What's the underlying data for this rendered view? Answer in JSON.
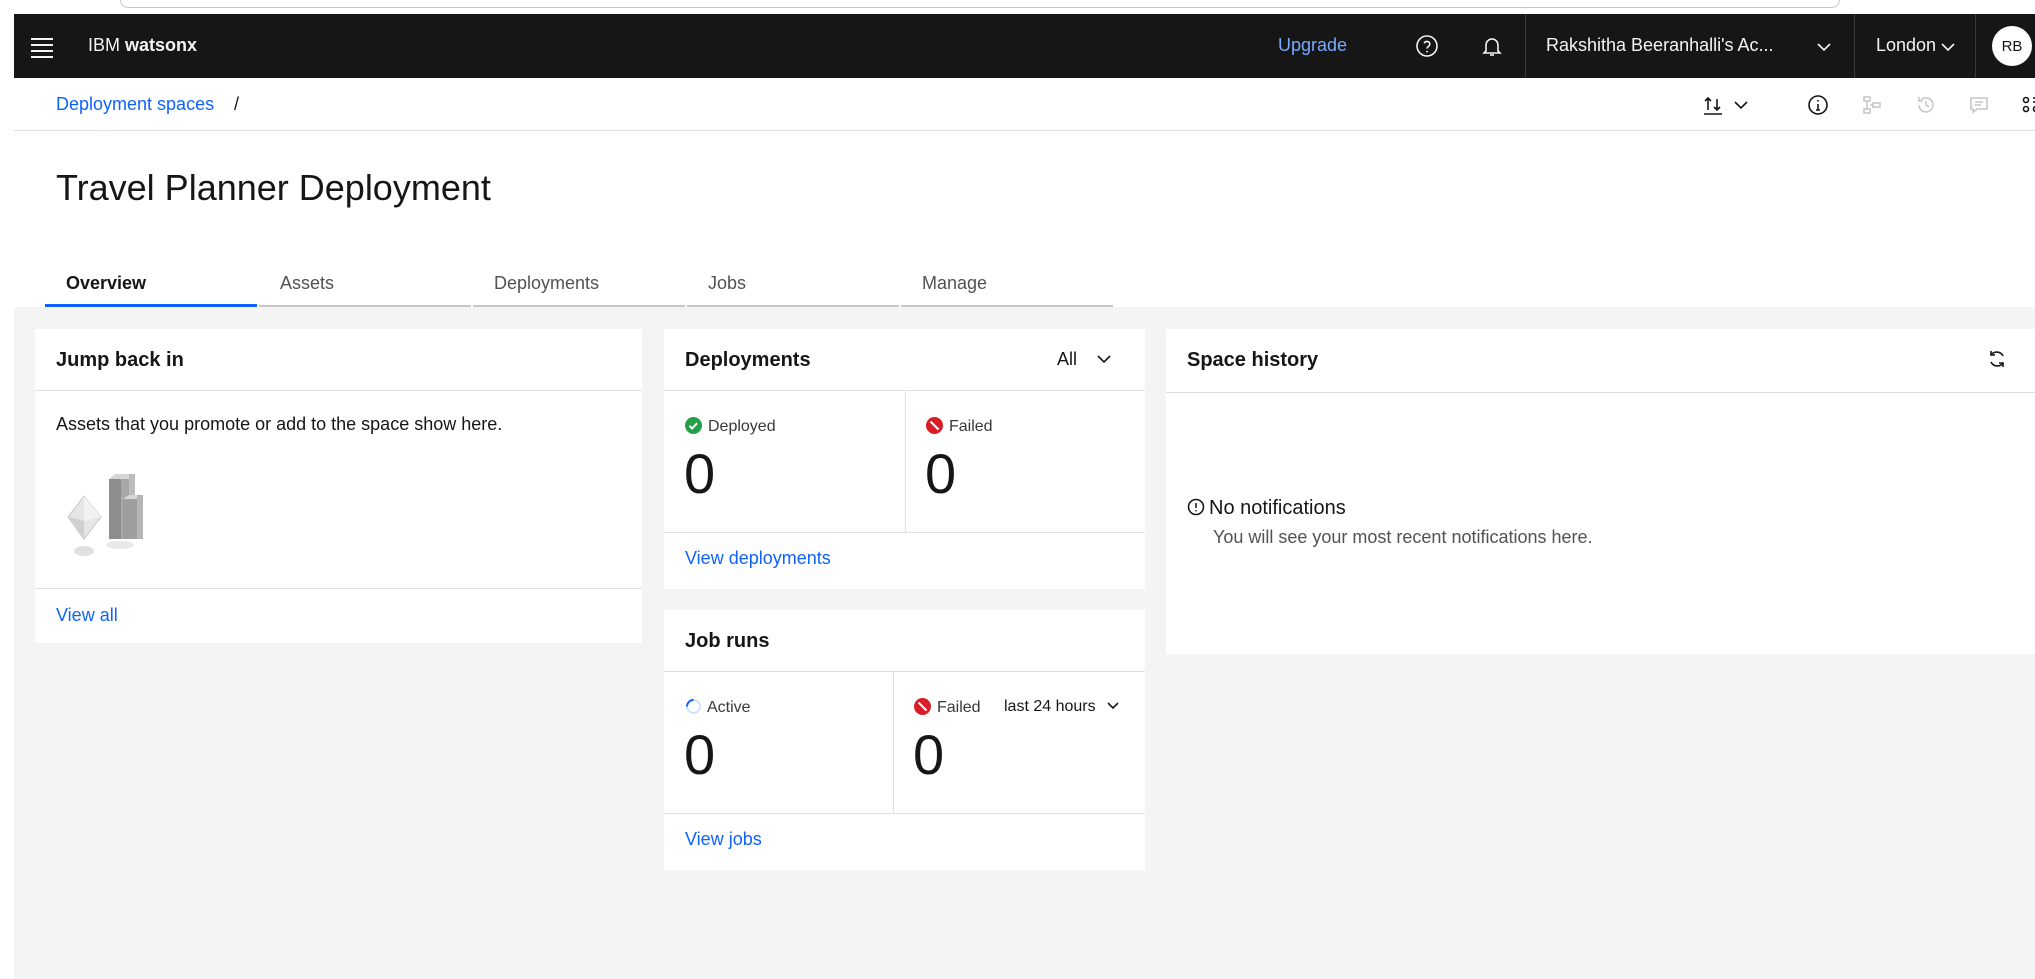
{
  "header": {
    "brand_prefix": "IBM",
    "brand_name": "watsonx",
    "upgrade_label": "Upgrade",
    "account_label": "Rakshitha Beeranhalli's Ac...",
    "region_label": "London",
    "avatar_initials": "RB"
  },
  "breadcrumb": {
    "items": [
      "Deployment spaces"
    ],
    "separator": "/"
  },
  "page": {
    "title": "Travel Planner Deployment"
  },
  "tabs": [
    {
      "label": "Overview",
      "active": true
    },
    {
      "label": "Assets",
      "active": false
    },
    {
      "label": "Deployments",
      "active": false
    },
    {
      "label": "Jobs",
      "active": false
    },
    {
      "label": "Manage",
      "active": false
    }
  ],
  "jump_back": {
    "title": "Jump back in",
    "empty_text": "Assets that you promote or add to the space show here.",
    "view_all_label": "View all"
  },
  "deployments_card": {
    "title": "Deployments",
    "filter_label": "All",
    "deployed_label": "Deployed",
    "deployed_count": "0",
    "failed_label": "Failed",
    "failed_count": "0",
    "view_label": "View deployments"
  },
  "job_runs": {
    "title": "Job runs",
    "active_label": "Active",
    "active_count": "0",
    "failed_label": "Failed",
    "failed_period": "last 24 hours",
    "failed_count": "0",
    "view_label": "View jobs"
  },
  "space_history": {
    "title": "Space history",
    "empty_title": "No notifications",
    "empty_text": "You will see your most recent notifications here."
  },
  "colors": {
    "brand_blue": "#0f62fe",
    "success_green": "#24a148",
    "error_red": "#da1e28",
    "header_bg": "#161616"
  }
}
